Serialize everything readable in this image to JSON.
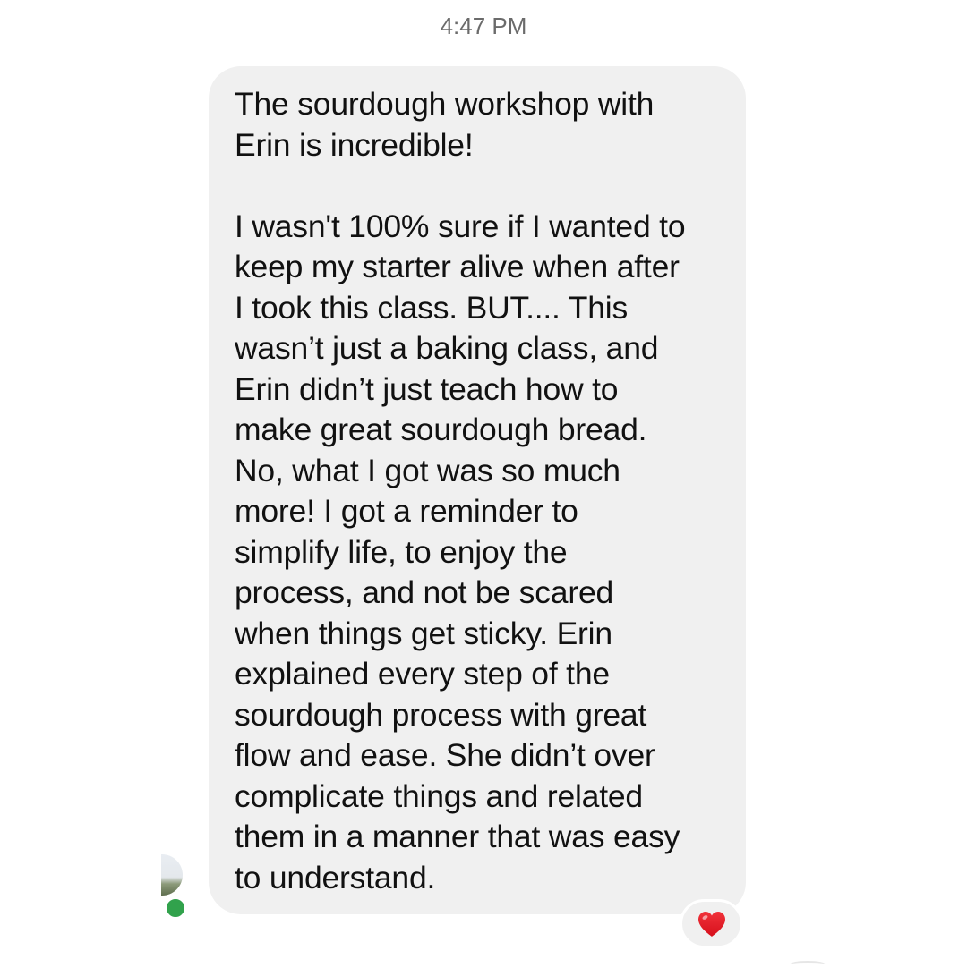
{
  "conversation": {
    "timestamp": "4:47 PM",
    "message": {
      "text": "The sourdough workshop with\nErin is incredible!\n\nI wasn't 100% sure if I wanted to\nkeep my starter alive when after\nI took this class. BUT.... This\nwasn’t just a baking class, and\nErin didn’t just teach how to\nmake great sourdough bread.\nNo, what I got was so much\nmore! I got a reminder to\nsimplify life, to enjoy the\nprocess, and not be scared\nwhen things get sticky. Erin\nexplained every step of the\nsourdough process with great\nflow and ease. She didn’t over\ncomplicate things and related\nthem in a manner that was easy\nto understand.",
      "bubble_color": "#f0f0f0",
      "reaction": {
        "icon": "red-heart-icon",
        "color": "#e0141e"
      }
    },
    "sender": {
      "avatar_icon": "avatar-photo",
      "status": "online",
      "status_color": "#31a24c"
    }
  }
}
